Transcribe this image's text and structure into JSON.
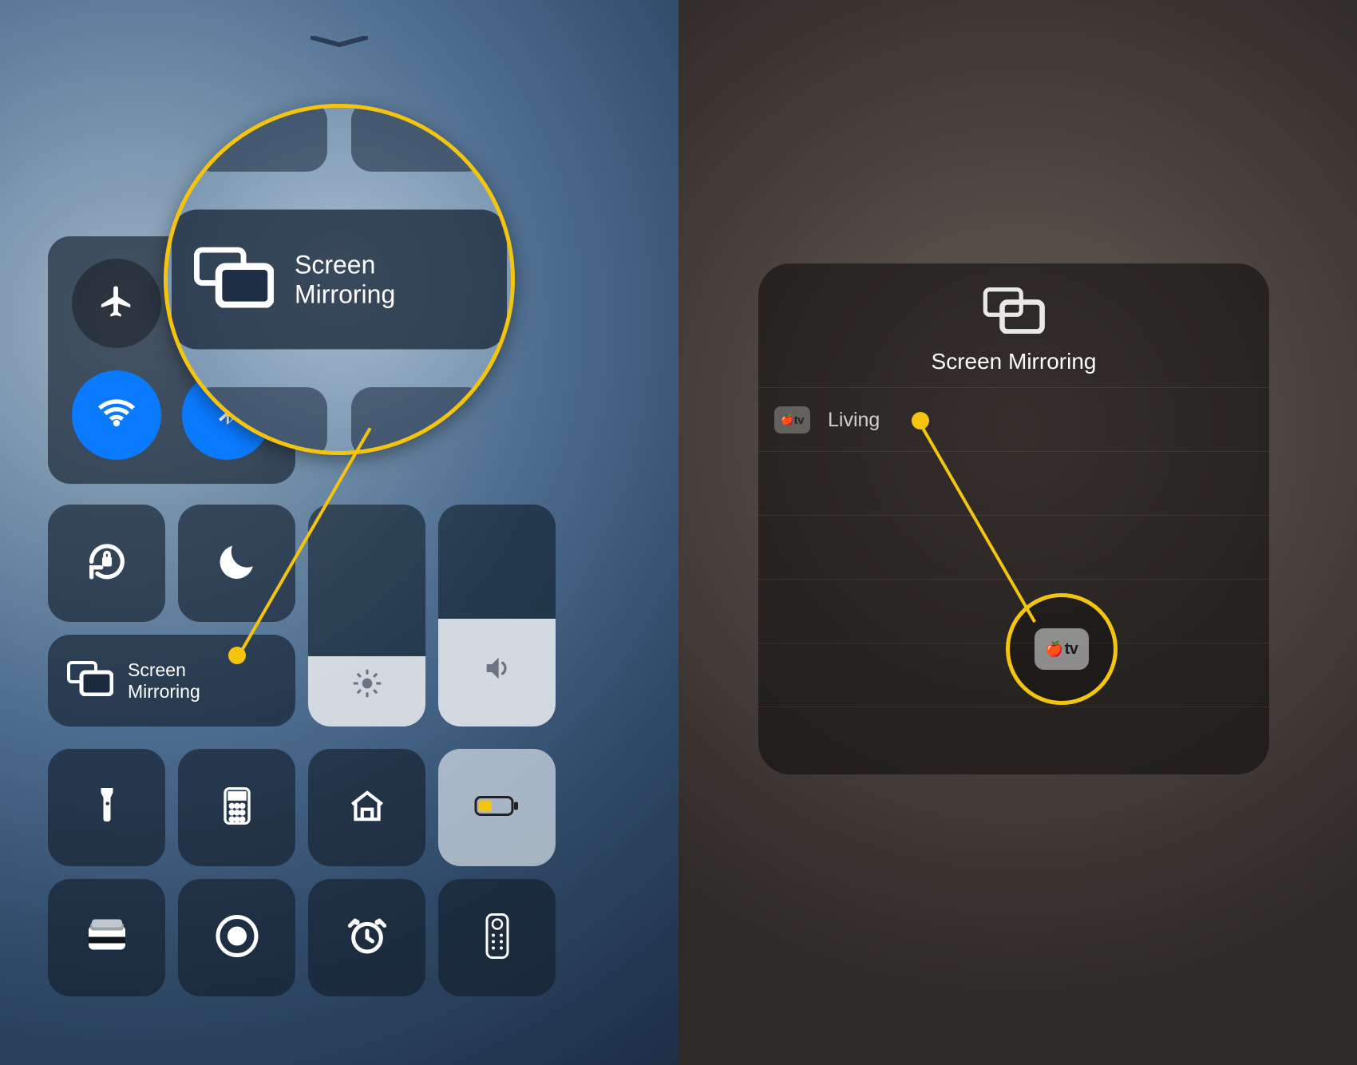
{
  "left": {
    "screen_mirroring": {
      "line1": "Screen",
      "line2": "Mirroring"
    },
    "zoom": {
      "line1": "Screen",
      "line2": "Mirroring"
    },
    "icons": {
      "airplane": "airplane-mode-icon",
      "cellular": "cellular-data-icon",
      "wifi": "wifi-icon",
      "bluetooth": "bluetooth-icon",
      "rotation": "rotation-lock-icon",
      "dnd": "do-not-disturb-icon",
      "brightness": "brightness-slider",
      "volume": "volume-slider",
      "flashlight": "flashlight-icon",
      "calculator": "calculator-icon",
      "home": "home-icon",
      "battery": "low-power-icon",
      "wallet": "wallet-icon",
      "record": "screen-record-icon",
      "alarm": "alarm-icon",
      "remote": "apple-tv-remote-icon"
    }
  },
  "right": {
    "header": "Screen Mirroring",
    "device": {
      "name": "Living",
      "chip": "tv"
    }
  },
  "colors": {
    "highlight": "#f4c40f",
    "wifi_on": "#0a7aff",
    "cell_on": "#34c759"
  }
}
